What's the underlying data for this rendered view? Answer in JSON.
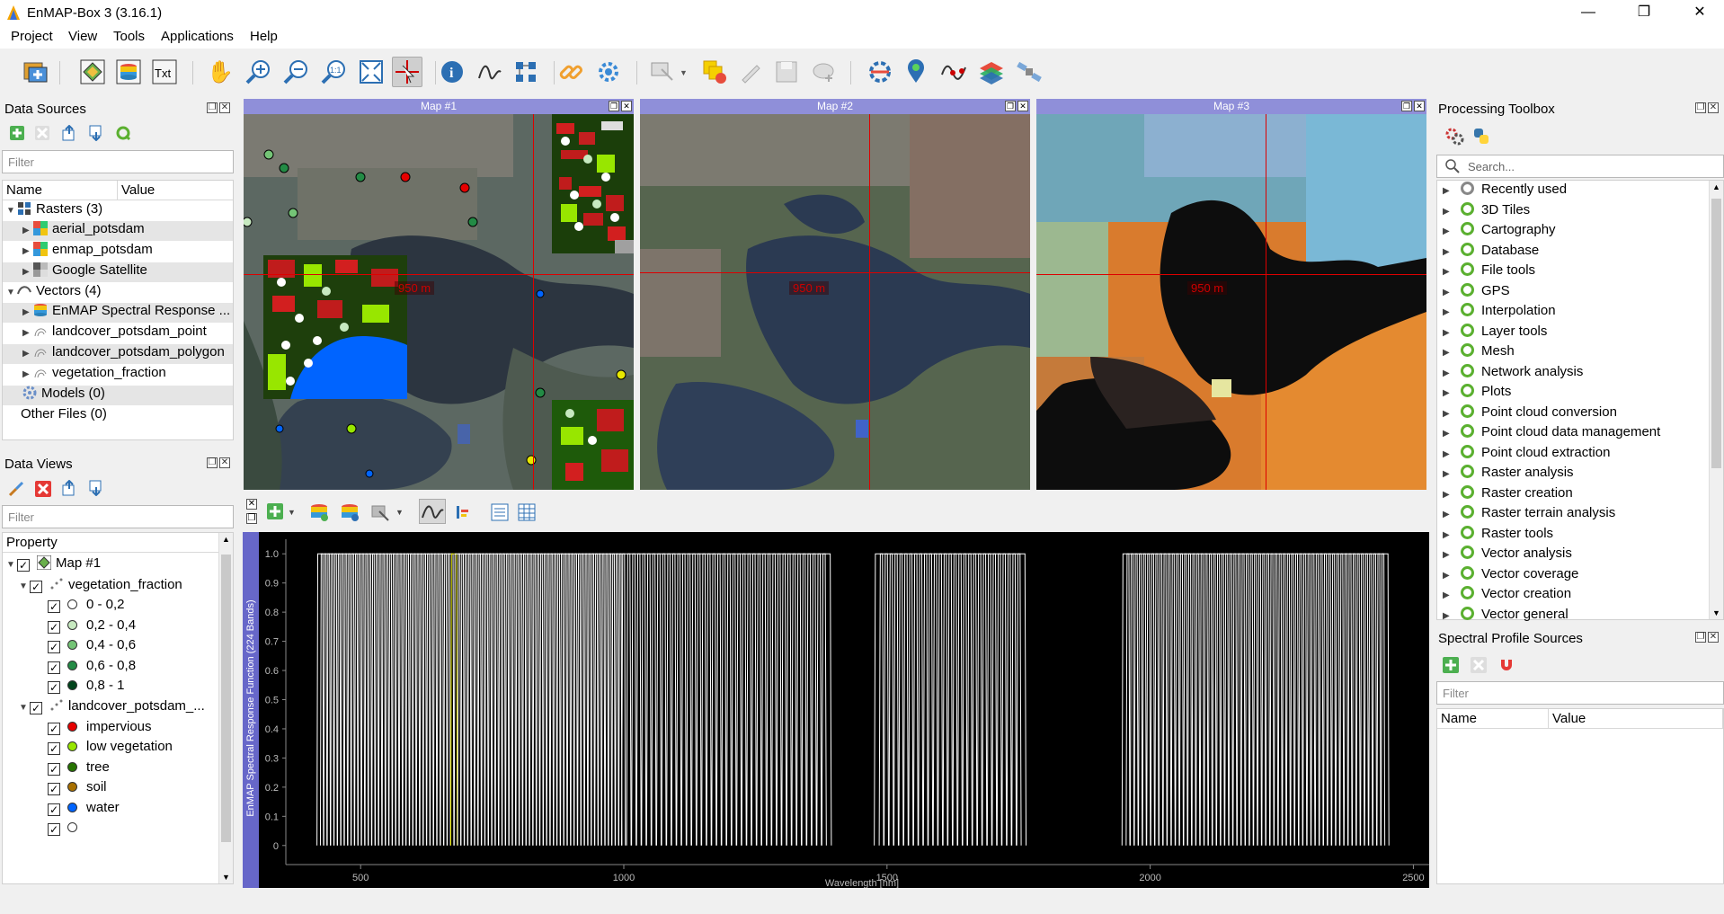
{
  "window": {
    "title": "EnMAP-Box 3 (3.16.1)",
    "controls": [
      "—",
      "❐",
      "✕"
    ]
  },
  "menu": [
    "Project",
    "View",
    "Tools",
    "Applications",
    "Help"
  ],
  "toolbar": {
    "icons": [
      "add-data-source-icon",
      "new-map-view-icon",
      "new-spectral-library-icon",
      "new-text-view-icon",
      "pan-icon",
      "zoom-in-icon",
      "zoom-out-icon",
      "zoom-native-icon",
      "zoom-full-icon",
      "select-location-icon",
      "identify-icon",
      "identify-profile-icon",
      "spectral-tool-icon",
      "link-views-icon",
      "settings-icon",
      "select-features-icon",
      "deselect-icon",
      "edit-pencil-icon",
      "save-edits-icon",
      "add-features-icon",
      "processing-icon",
      "location-pin-icon",
      "wave-icon",
      "layers-icon",
      "satellite-icon"
    ],
    "txt_label": "Txt"
  },
  "data_sources": {
    "title": "Data Sources",
    "filter_placeholder": "Filter",
    "columns": [
      "Name",
      "Value"
    ],
    "rasters": {
      "label": "Rasters (3)",
      "items": [
        "aerial_potsdam",
        "enmap_potsdam",
        "Google Satellite"
      ]
    },
    "vectors": {
      "label": "Vectors (4)",
      "items": [
        "EnMAP Spectral Response ...",
        "landcover_potsdam_point",
        "landcover_potsdam_polygon",
        "vegetation_fraction"
      ]
    },
    "models": "Models (0)",
    "other_files": "Other Files (0)"
  },
  "data_views": {
    "title": "Data Views",
    "filter_placeholder": "Filter",
    "column": "Property",
    "map": "Map #1",
    "layer1": {
      "label": "vegetation_fraction",
      "classes": [
        {
          "label": "0 - 0,2",
          "color": "#ffffff"
        },
        {
          "label": "0,2 - 0,4",
          "color": "#c7e9c0"
        },
        {
          "label": "0,4 - 0,6",
          "color": "#74c476"
        },
        {
          "label": "0,6 - 0,8",
          "color": "#238b45"
        },
        {
          "label": "0,8 - 1",
          "color": "#00441b"
        }
      ]
    },
    "layer2": {
      "label": "landcover_potsdam_...",
      "classes": [
        {
          "label": "impervious",
          "color": "#e60000"
        },
        {
          "label": "low vegetation",
          "color": "#98e600"
        },
        {
          "label": "tree",
          "color": "#267300"
        },
        {
          "label": "soil",
          "color": "#a87000"
        },
        {
          "label": "water",
          "color": "#0064ff"
        },
        {
          "label": "",
          "color": "#ffffff"
        }
      ]
    }
  },
  "maps": [
    {
      "title": "Map #1",
      "scale": "950 m"
    },
    {
      "title": "Map #2",
      "scale": "950 m"
    },
    {
      "title": "Map #3",
      "scale": "950 m"
    }
  ],
  "processing_toolbox": {
    "title": "Processing Toolbox",
    "search_placeholder": "Search...",
    "items": [
      "Recently used",
      "3D Tiles",
      "Cartography",
      "Database",
      "File tools",
      "GPS",
      "Interpolation",
      "Layer tools",
      "Mesh",
      "Network analysis",
      "Plots",
      "Point cloud conversion",
      "Point cloud data management",
      "Point cloud extraction",
      "Raster analysis",
      "Raster creation",
      "Raster terrain analysis",
      "Raster tools",
      "Vector analysis",
      "Vector coverage",
      "Vector creation",
      "Vector general"
    ]
  },
  "spectral_profile_sources": {
    "title": "Spectral Profile Sources",
    "filter_placeholder": "Filter",
    "columns": [
      "Name",
      "Value"
    ]
  },
  "chart_data": {
    "type": "line",
    "title": "",
    "xlabel": "Wavelength [nm]",
    "ylabel": "EnMAP Spectral Response Function (224 Bands)",
    "xlim": [
      375,
      2530
    ],
    "ylim": [
      -0.05,
      1.05
    ],
    "xticks": [
      500,
      1000,
      1500,
      2000,
      2500
    ],
    "yticks": [
      0,
      0.1,
      0.2,
      0.3,
      0.4,
      0.5,
      0.6,
      0.7,
      0.8,
      0.9,
      1.0
    ],
    "band_ranges_nm": [
      [
        420,
        1000
      ],
      [
        1000,
        1390
      ],
      [
        1480,
        1760
      ],
      [
        1950,
        2450
      ]
    ],
    "band_counts": [
      89,
      41,
      30,
      64
    ],
    "peak_value": 1.0,
    "highlight_band_nm": 675,
    "series_color": "#ffffff",
    "highlight_color": "#e8e800",
    "grid": false
  }
}
